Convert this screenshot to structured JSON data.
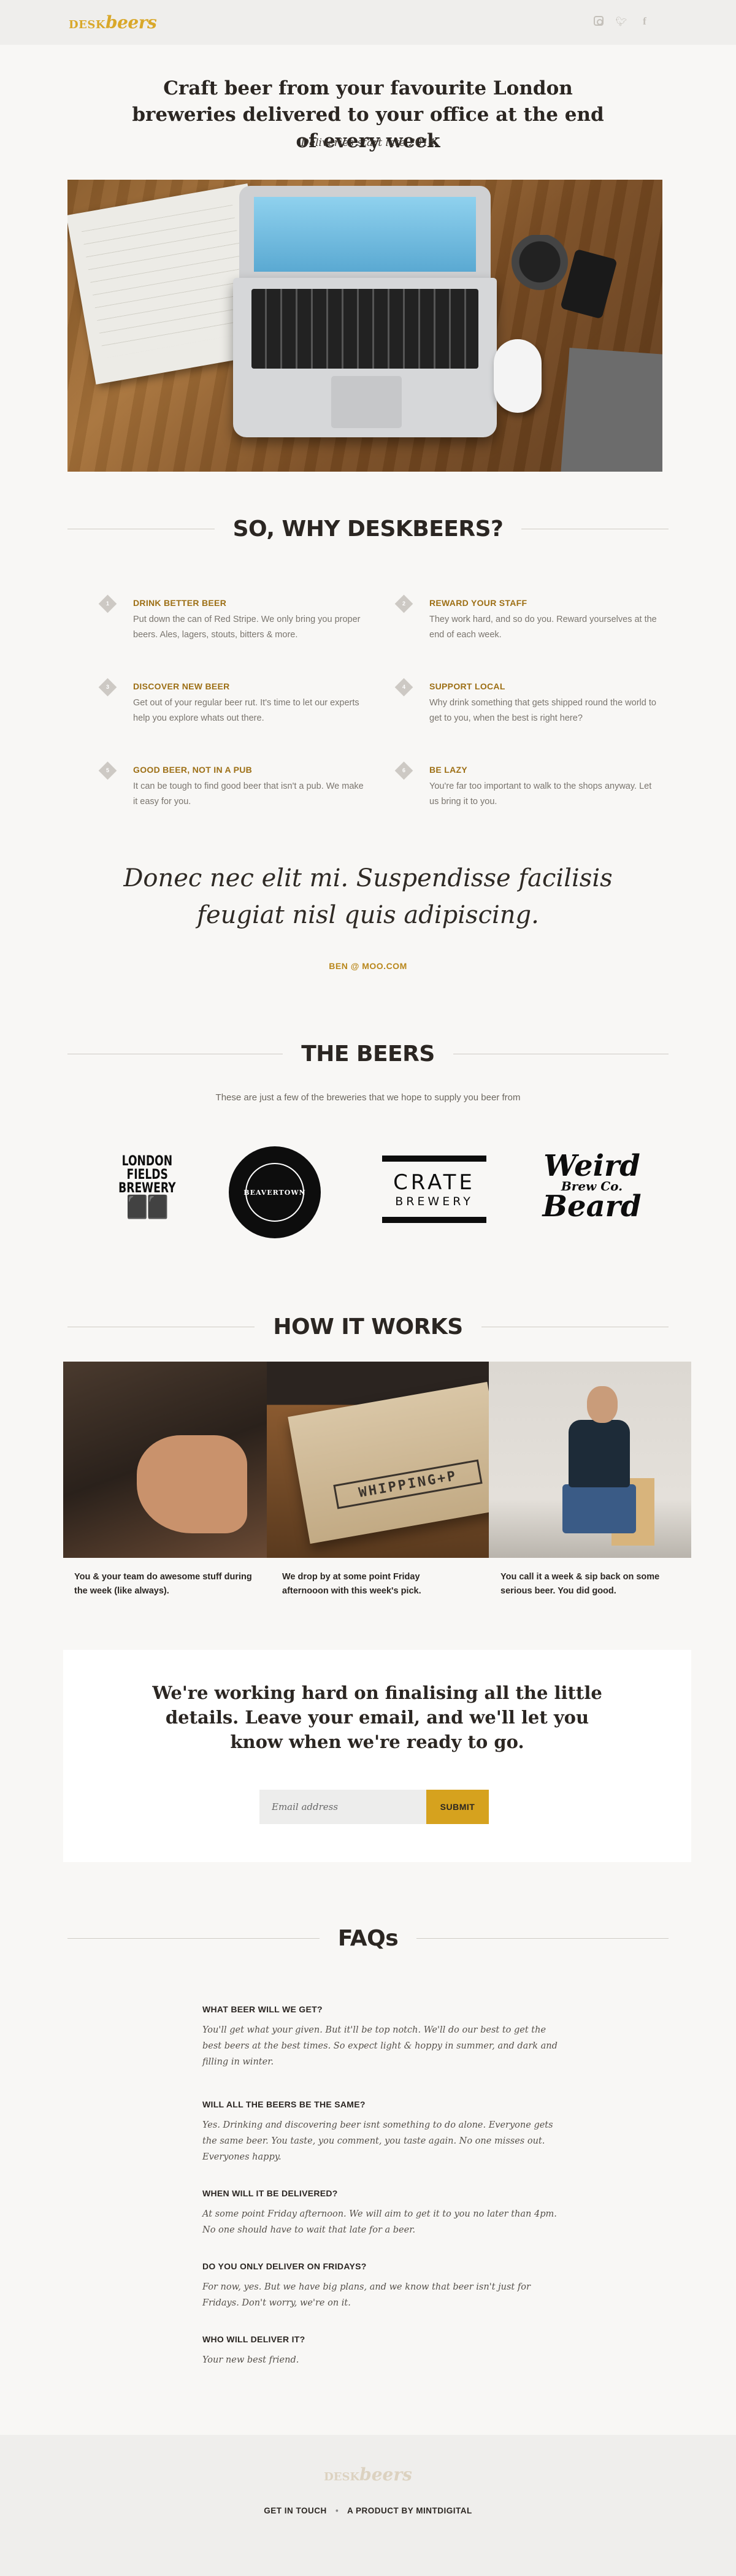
{
  "header": {
    "logo_part1": "DESK",
    "logo_part2": "beers",
    "social_icons": [
      "instagram-icon",
      "twitter-icon",
      "facebook-icon"
    ]
  },
  "hero": {
    "title": "Craft beer from your favourite London breweries delivered to your office at the end of every week",
    "subtitle": "Deliveries start late 2014"
  },
  "why": {
    "heading": "SO, WHY DESKBEERS?",
    "features": [
      {
        "num": "1",
        "title": "DRINK BETTER BEER",
        "text": "Put down the can of Red Stripe. We only bring you proper beers. Ales, lagers, stouts, bitters & more."
      },
      {
        "num": "2",
        "title": "REWARD YOUR STAFF",
        "text": "They work hard, and so do you. Reward yourselves at the end of each week."
      },
      {
        "num": "3",
        "title": "DISCOVER NEW BEER",
        "text": "Get out of your regular beer rut. It's time to let our experts help you explore whats out there."
      },
      {
        "num": "4",
        "title": "SUPPORT LOCAL",
        "text": "Why drink something that gets shipped round the world to get to you, when the best is right here?"
      },
      {
        "num": "5",
        "title": "GOOD BEER, NOT IN A PUB",
        "text": "It can be tough to find good beer that isn't a pub. We make it easy for you."
      },
      {
        "num": "6",
        "title": "BE LAZY",
        "text": "You're far too important to walk to the shops anyway. Let us bring it to you."
      }
    ]
  },
  "testimonial": {
    "quote": "Donec nec elit mi. Suspendisse facilisis feugiat nisl quis adipiscing.",
    "author": "BEN @ MOO.COM"
  },
  "beers": {
    "heading": "THE BEERS",
    "subtitle": "These are just a few of the breweries that we hope to supply you beer from",
    "breweries": {
      "london": [
        "LONDON",
        "FIELDS",
        "BREWERY"
      ],
      "beavertown": "BEAVERTOWN",
      "crate": [
        "CRATE",
        "BREWERY"
      ],
      "weird": [
        "Weird",
        "Brew Co.",
        "Beard"
      ]
    }
  },
  "how": {
    "heading": "HOW IT WORKS",
    "box_stamp": "WHIPPING+P",
    "steps": [
      "You & your team do awesome stuff during the week (like always).",
      "We drop by at some point Friday afternooon with this week's pick.",
      "You call it a week & sip back on some serious beer. You did good."
    ]
  },
  "signup": {
    "title": "We're working hard on finalising all the little details. Leave your email, and we'll let you know when we're ready to go.",
    "email_placeholder": "Email address",
    "submit_label": "SUBMIT"
  },
  "faqs": {
    "heading": "FAQs",
    "items": [
      {
        "q": "WHAT BEER WILL WE GET?",
        "a": "You'll get what your given. But it'll be top notch. We'll do our best to get the best beers at the best times. So expect light & hoppy in summer, and dark and filling in winter."
      },
      {
        "q": "WILL ALL THE BEERS BE THE SAME?",
        "a": "Yes. Drinking and discovering beer isnt something to do alone. Everyone gets the same beer. You taste, you comment, you taste again. No one misses out. Everyones happy."
      },
      {
        "q": "WHEN WILL IT BE DELIVERED?",
        "a": "At some point Friday afternoon. We will aim to get it to you no later than 4pm. No one should have to wait that late for a beer."
      },
      {
        "q": "DO YOU ONLY DELIVER ON FRIDAYS?",
        "a": "For now, yes. But we have big plans, and we know that beer isn't just for Fridays. Don't worry, we're on it."
      },
      {
        "q": "WHO WILL DELIVER IT?",
        "a": "Your new best friend."
      }
    ]
  },
  "footer": {
    "logo_part1": "DESK",
    "logo_part2": "beers",
    "link1": "GET IN TOUCH",
    "separator": "•",
    "link2": "A PRODUCT BY MINTDIGITAL"
  },
  "colors": {
    "accent": "#d6a21e",
    "feature_title": "#9d6f15",
    "text_dark": "#2b2622"
  }
}
